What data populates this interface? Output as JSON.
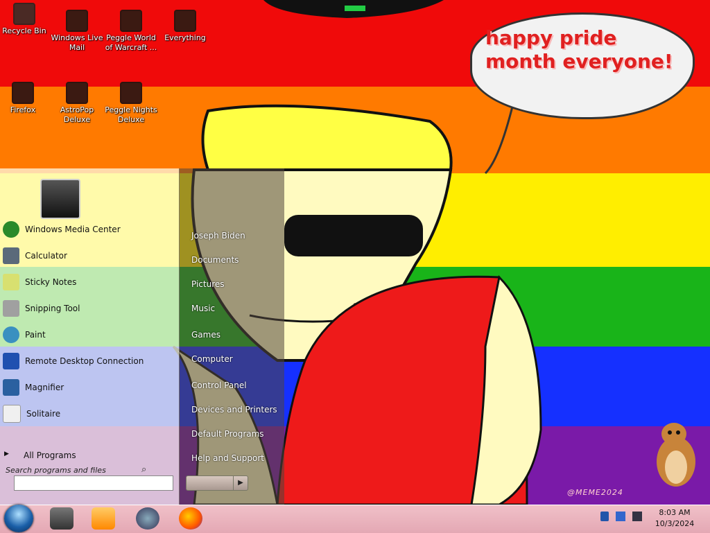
{
  "wallpaper": {
    "stripes": [
      "#f00a0a",
      "#ff7a00",
      "#ffee00",
      "#19b419",
      "#1530ff",
      "#7a1aa8"
    ],
    "speech_bubble": "happy pride month everyone!",
    "watermark": "@MEME2024"
  },
  "desktop_icons": [
    {
      "label": "Recycle Bin",
      "icon": "recycle-bin-icon"
    },
    {
      "label": "Windows Live Mail",
      "icon": "mail-icon"
    },
    {
      "label": "Peggle World of Warcraft ...",
      "icon": "peggle-icon"
    },
    {
      "label": "Everything",
      "icon": "search-icon"
    },
    {
      "label": "Firefox",
      "icon": "firefox-icon"
    },
    {
      "label": "AstroPop Deluxe",
      "icon": "astropop-icon"
    },
    {
      "label": "Peggle Nights Deluxe",
      "icon": "peggle-nights-icon"
    }
  ],
  "start_menu": {
    "user_picture": "user-picture-icon",
    "programs": [
      {
        "label": "Windows Media Center",
        "icon": "media-center-icon"
      },
      {
        "label": "Calculator",
        "icon": "calculator-icon"
      },
      {
        "label": "Sticky Notes",
        "icon": "sticky-notes-icon"
      },
      {
        "label": "Snipping Tool",
        "icon": "snipping-tool-icon"
      },
      {
        "label": "Paint",
        "icon": "paint-icon"
      },
      {
        "label": "Remote Desktop Connection",
        "icon": "remote-desktop-icon"
      },
      {
        "label": "Magnifier",
        "icon": "magnifier-icon"
      },
      {
        "label": "Solitaire",
        "icon": "solitaire-icon"
      }
    ],
    "all_programs": "All Programs",
    "search_placeholder": "Search programs and files",
    "right_links": [
      "Joseph Biden",
      "Documents",
      "Pictures",
      "Music",
      "Games",
      "Computer",
      "Control Panel",
      "Devices and Printers",
      "Default Programs",
      "Help and Support"
    ]
  },
  "taskbar": {
    "apps": [
      "windows-explorer-icon",
      "media-player-icon",
      "game-icon",
      "firefox-icon"
    ],
    "time": "8:03 AM",
    "date": "10/3/2024"
  }
}
